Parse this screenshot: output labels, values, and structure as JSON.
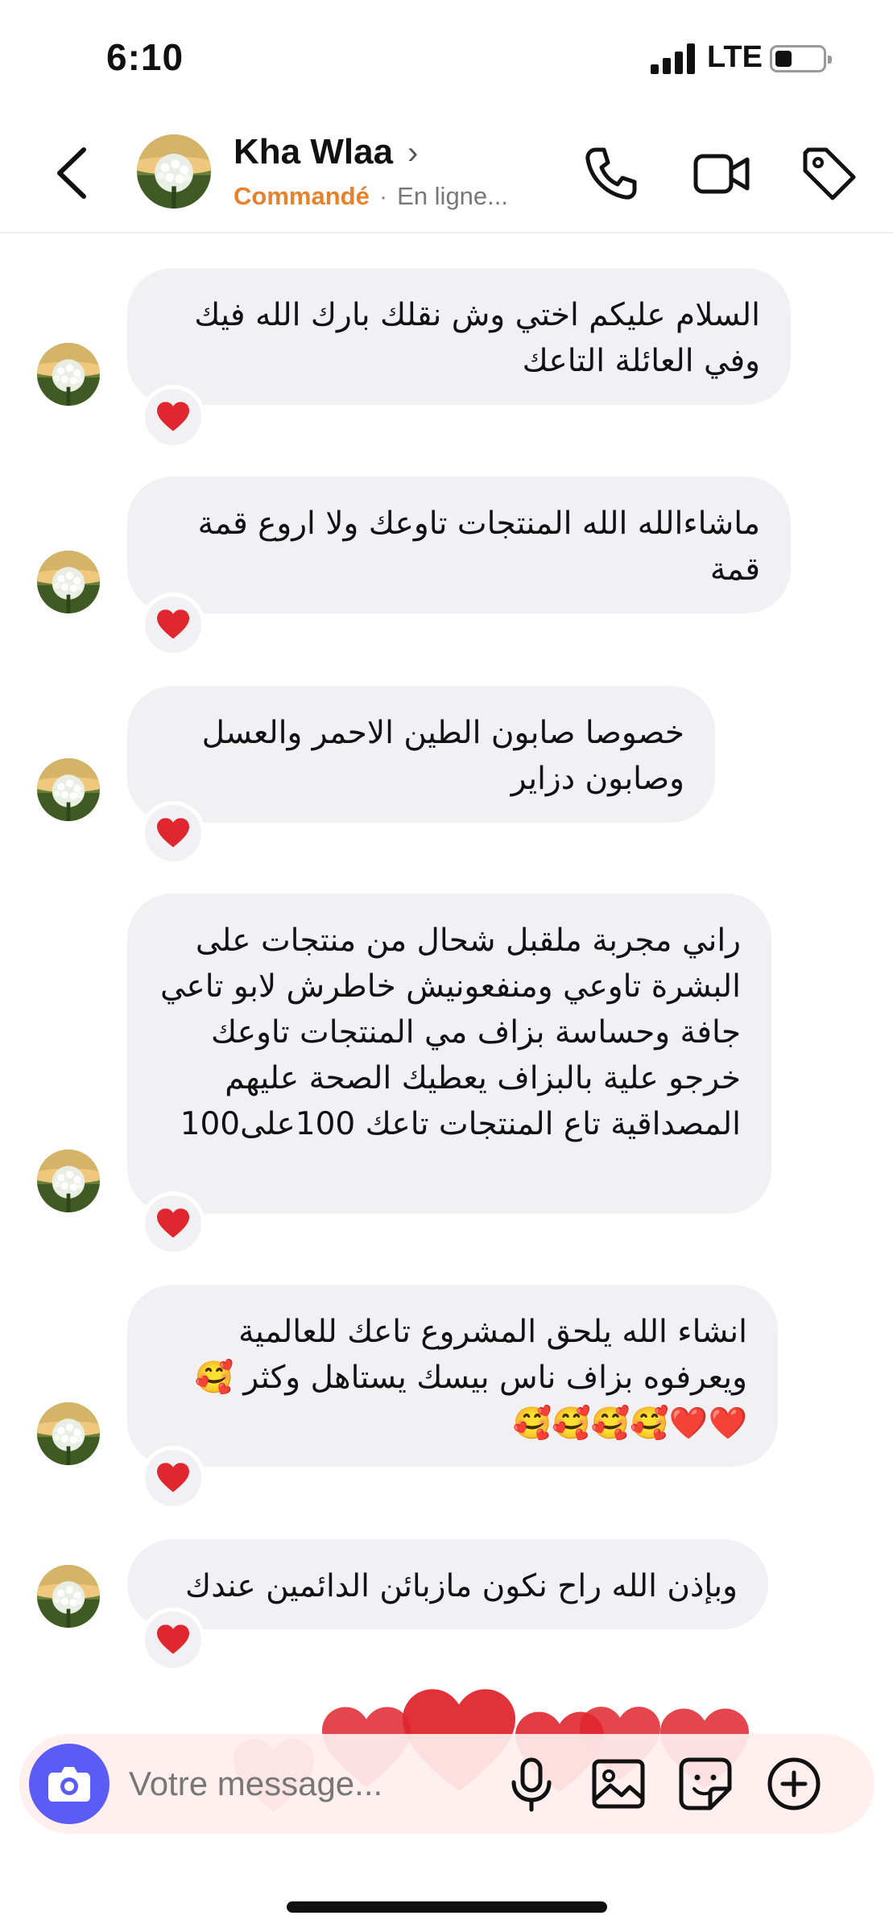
{
  "status_bar": {
    "time": "6:10",
    "network": "LTE",
    "battery_level": 0.3
  },
  "header": {
    "contact_name": "Kha Wlaa",
    "order_status": "Commandé",
    "presence": "En ligne..."
  },
  "messages": [
    {
      "text": "السلام عليكم اختي وش نقلك بارك الله فيك وفي العائلة التاعك",
      "reaction": "heart-emoji"
    },
    {
      "text": "ماشاءالله الله المنتجات تاوعك ولا اروع قمة قمة",
      "reaction": "heart-emoji"
    },
    {
      "text": "خصوصا صابون الطين الاحمر والعسل وصابون دزاير",
      "reaction": "heart-emoji"
    },
    {
      "text": "راني مجربة ملقبل شحال من منتجات على البشرة تاوعي ومنفعونيش خاطرش لابو تاعي جافة وحساسة بزاف مي المنتجات تاوعك خرجو علية بالبزاف يعطيك الصحة عليهم المصداقية تاع المنتجات تاعك 100على100",
      "reaction": "heart-emoji"
    },
    {
      "text": "انشاء الله يلحق المشروع تاعك للعالمية ويعرفوه بزاف ناس بيسك يستاهل وكثر 🥰 ❤️❤️🥰🥰🥰🥰",
      "reaction": "heart-emoji"
    },
    {
      "text": "وبإذن الله راح نكون مازبائن الدائمين عندك",
      "reaction": "heart-emoji"
    }
  ],
  "composer": {
    "placeholder": "Votre message..."
  },
  "colors": {
    "accent": "#5b5bf6",
    "order_status": "#e6822b",
    "bubble": "#f1f1f3",
    "heart": "#e0262f"
  }
}
